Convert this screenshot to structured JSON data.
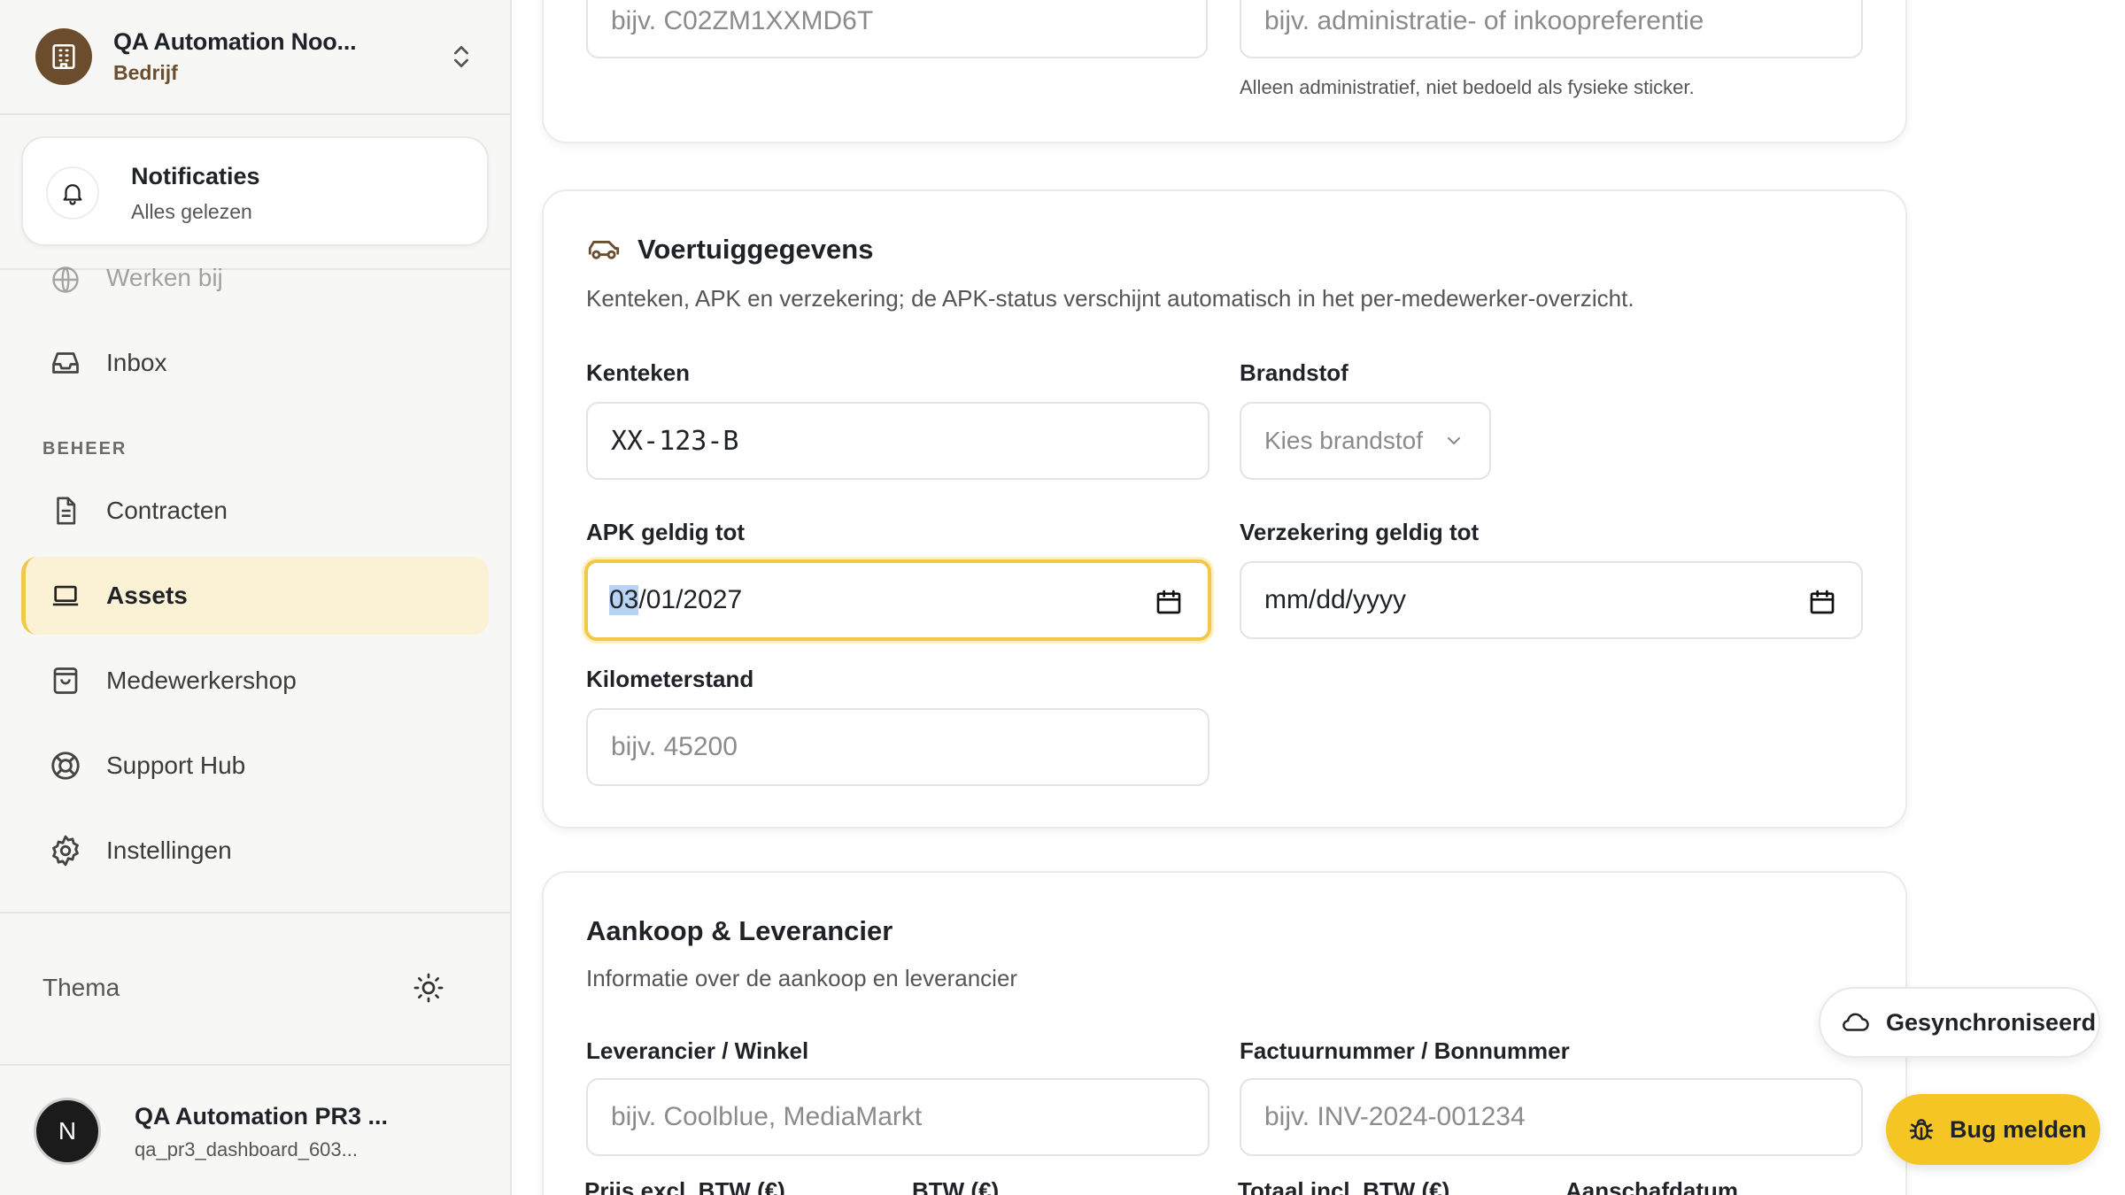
{
  "sidebar": {
    "org_name": "QA Automation Noo...",
    "org_type": "Bedrijf",
    "notifications": {
      "title": "Notificaties",
      "subtitle": "Alles gelezen"
    },
    "items_top": [
      {
        "label": "Werken bij",
        "icon": "globe-icon"
      },
      {
        "label": "Inbox",
        "icon": "inbox-icon"
      }
    ],
    "section_label": "BEHEER",
    "items": [
      {
        "label": "Contracten",
        "icon": "document-icon"
      },
      {
        "label": "Assets",
        "icon": "laptop-icon",
        "active": true
      },
      {
        "label": "Medewerkershop",
        "icon": "shopping-bag-icon"
      },
      {
        "label": "Support Hub",
        "icon": "lifebuoy-icon"
      },
      {
        "label": "Instellingen",
        "icon": "gear-icon"
      }
    ],
    "theme_label": "Thema",
    "user": {
      "initials": "N",
      "name": "QA Automation PR3 ...",
      "handle": "qa_pr3_dashboard_603..."
    }
  },
  "top_card": {
    "serial_placeholder": "bijv. C02ZM1XXMD6T",
    "reference_placeholder": "bijv. administratie- of inkoopreferentie",
    "reference_hint": "Alleen administratief, niet bedoeld als fysieke sticker."
  },
  "vehicle": {
    "title": "Voertuiggegevens",
    "description": "Kenteken, APK en verzekering; de APK-status verschijnt automatisch in het per-medewerker-overzicht.",
    "plate_label": "Kenteken",
    "plate_value": "XX-123-B",
    "fuel_label": "Brandstof",
    "fuel_placeholder": "Kies brandstof",
    "apk_label": "APK geldig tot",
    "apk_value_month": "03",
    "apk_value_rest": "/01/2027",
    "insurance_label": "Verzekering geldig tot",
    "insurance_placeholder": "mm/dd/yyyy",
    "mileage_label": "Kilometerstand",
    "mileage_placeholder": "bijv. 45200"
  },
  "purchase": {
    "title": "Aankoop & Leverancier",
    "description": "Informatie over de aankoop en leverancier",
    "supplier_label": "Leverancier / Winkel",
    "supplier_placeholder": "bijv. Coolblue, MediaMarkt",
    "invoice_label": "Factuurnummer / Bonnummer",
    "invoice_placeholder": "bijv. INV-2024-001234",
    "price_label": "Prijs excl. BTW (€)",
    "vat_label": "BTW (€)",
    "total_label": "Totaal incl. BTW (€)",
    "date_label": "Aanschafdatum"
  },
  "status": {
    "sync_label": "Gesynchroniseerd",
    "bug_label": "Bug melden"
  },
  "colors": {
    "accent": "#f5c523",
    "active_bg": "#fbf2d6",
    "brand_brown": "#6b4d2e"
  }
}
